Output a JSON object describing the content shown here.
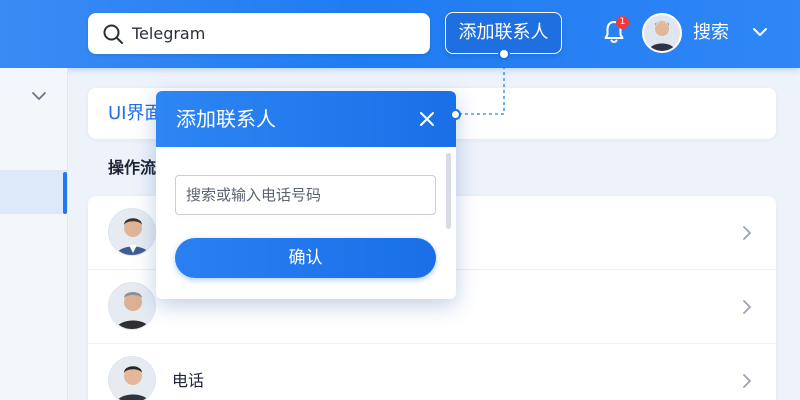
{
  "header": {
    "search_value": "Telegram",
    "add_contact_label": "添加联系人",
    "notification_count": "1",
    "search_label": "搜索"
  },
  "main": {
    "title_card_text": "UI界面",
    "section_heading": "操作流",
    "contacts": [
      {
        "label": ""
      },
      {
        "label": ""
      },
      {
        "label": "电话"
      }
    ]
  },
  "popup": {
    "title": "添加联系人",
    "input_placeholder": "搜索或输入电话号码",
    "confirm_label": "确认"
  },
  "colors": {
    "brand_blue": "#1f7cf1",
    "badge_red": "#ef3b3b"
  }
}
